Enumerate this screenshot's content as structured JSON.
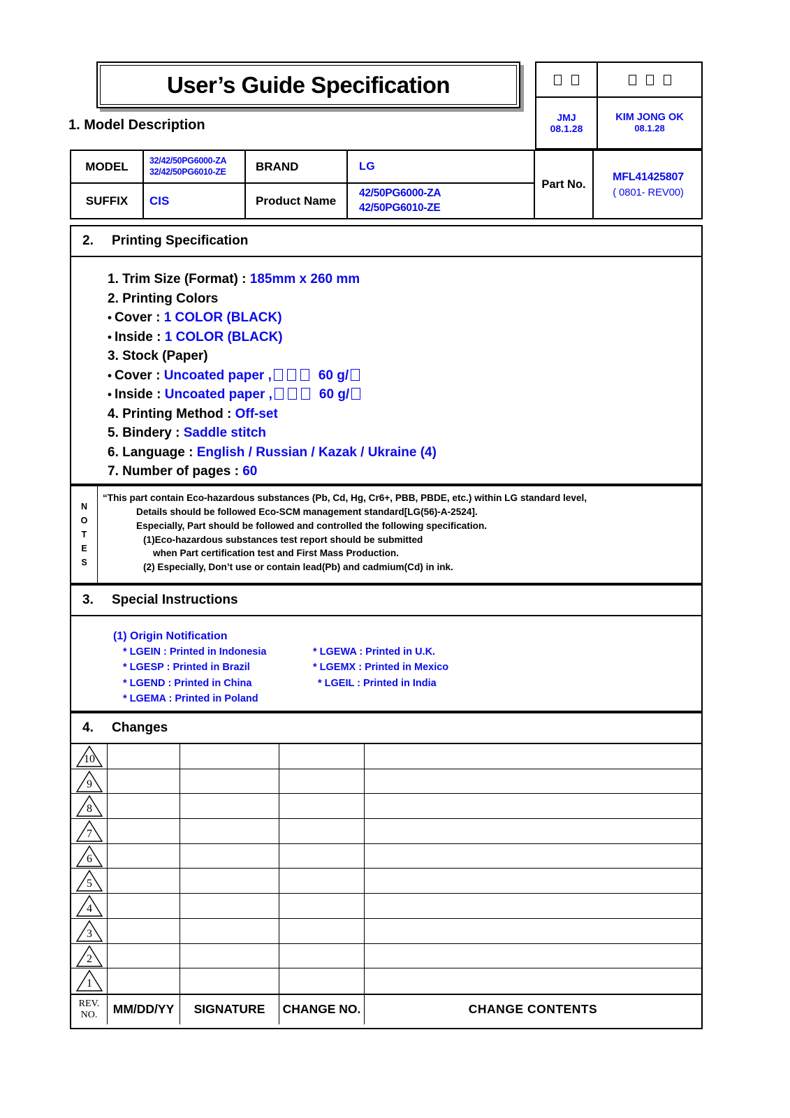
{
  "document": {
    "title": "User’s Guide Specification"
  },
  "approval": {
    "columns": [
      {
        "header_boxes": 2,
        "name": "JMJ",
        "date": "08.1.28"
      },
      {
        "header_boxes": 3,
        "name": "KIM JONG OK",
        "date": "08.1.28"
      }
    ]
  },
  "section1": {
    "heading": "1. Model Description",
    "labels": {
      "model": "MODEL",
      "suffix": "SUFFIX",
      "brand": "BRAND",
      "product_name": "Product Name",
      "part_no": "Part No."
    },
    "values": {
      "model_line1": "32/42/50PG6000-ZA",
      "model_line2": "32/42/50PG6010-ZE",
      "suffix": "CIS",
      "brand": "LG",
      "product_name_line1": "42/50PG6000-ZA",
      "product_name_line2": "42/50PG6010-ZE",
      "part_no": "MFL41425807",
      "part_rev": "( 0801- REV00)"
    }
  },
  "section2": {
    "number": "2.",
    "heading": "Printing Specification",
    "lines": [
      {
        "label": "1. Trim Size (Format) : ",
        "value": "185mm x 260 mm",
        "bullet": false,
        "tofu": 0
      },
      {
        "label": "2. Printing Colors",
        "value": "",
        "bullet": false,
        "tofu": 0
      },
      {
        "label": "Cover : ",
        "value": "1 COLOR (BLACK)",
        "bullet": true,
        "tofu": 0
      },
      {
        "label": "Inside : ",
        "value": "1 COLOR (BLACK)",
        "bullet": true,
        "tofu": 0
      },
      {
        "label": "3. Stock (Paper)",
        "value": "",
        "bullet": false,
        "tofu": 0
      },
      {
        "label": "Cover : ",
        "value": "Uncoated paper ,",
        "value_tail": "60 g/",
        "bullet": true,
        "tofu": 3,
        "tofu_tail": 1
      },
      {
        "label": "Inside : ",
        "value": "Uncoated paper ,",
        "value_tail": "60 g/",
        "bullet": true,
        "tofu": 3,
        "tofu_tail": 1
      },
      {
        "label": "4. Printing Method : ",
        "value": "Off-set",
        "bullet": false,
        "tofu": 0
      },
      {
        "label": "5. Bindery  : ",
        "value": "Saddle stitch",
        "bullet": false,
        "tofu": 0
      },
      {
        "label": "6. Language : ",
        "value": "English / Russian / Kazak / Ukraine (4)",
        "bullet": false,
        "tofu": 0
      },
      {
        "label": "7. Number of pages : ",
        "value": "60",
        "bullet": false,
        "tofu": 0
      }
    ]
  },
  "notes": {
    "label_letters": [
      "N",
      "O",
      "T",
      "E",
      "S"
    ],
    "lines": [
      "“This part contain Eco-hazardous substances (Pb, Cd, Hg, Cr6+, PBB, PBDE, etc.) within LG standard level,",
      "Details should be followed Eco-SCM management standard[LG(56)-A-2524].",
      "Especially, Part should be followed and controlled the following specification.",
      "(1)Eco-hazardous substances test report should be submitted",
      "when  Part certification test and First Mass Production.",
      "(2) Especially, Don’t use or contain lead(Pb) and cadmium(Cd) in ink."
    ]
  },
  "section3": {
    "number": "3.",
    "heading": "Special Instructions",
    "origin_title": "(1) Origin Notification",
    "origin_rows": [
      {
        "left": "* LGEIN : Printed in Indonesia",
        "right": "* LGEWA : Printed in U.K."
      },
      {
        "left": "* LGESP : Printed in Brazil",
        "right": "* LGEMX : Printed in Mexico"
      },
      {
        "left": "* LGEND : Printed in China",
        "right": "* LGEIL : Printed in India"
      },
      {
        "left": "* LGEMA : Printed in Poland",
        "right": ""
      }
    ]
  },
  "section4": {
    "number": "4.",
    "heading": "Changes",
    "rev_numbers": [
      "10",
      "9",
      "8",
      "7",
      "6",
      "5",
      "4",
      "3",
      "2",
      "1"
    ],
    "footer": {
      "rev_no_line1": "REV.",
      "rev_no_line2": "NO.",
      "date": "MM/DD/YY",
      "signature": "SIGNATURE",
      "change_no": "CHANGE NO.",
      "change_contents": "CHANGE   CONTENTS"
    }
  },
  "colors": {
    "accent_blue": "#0B0BE8",
    "ink_black": "#000000",
    "shadow_gray": "#9a9a9a"
  }
}
